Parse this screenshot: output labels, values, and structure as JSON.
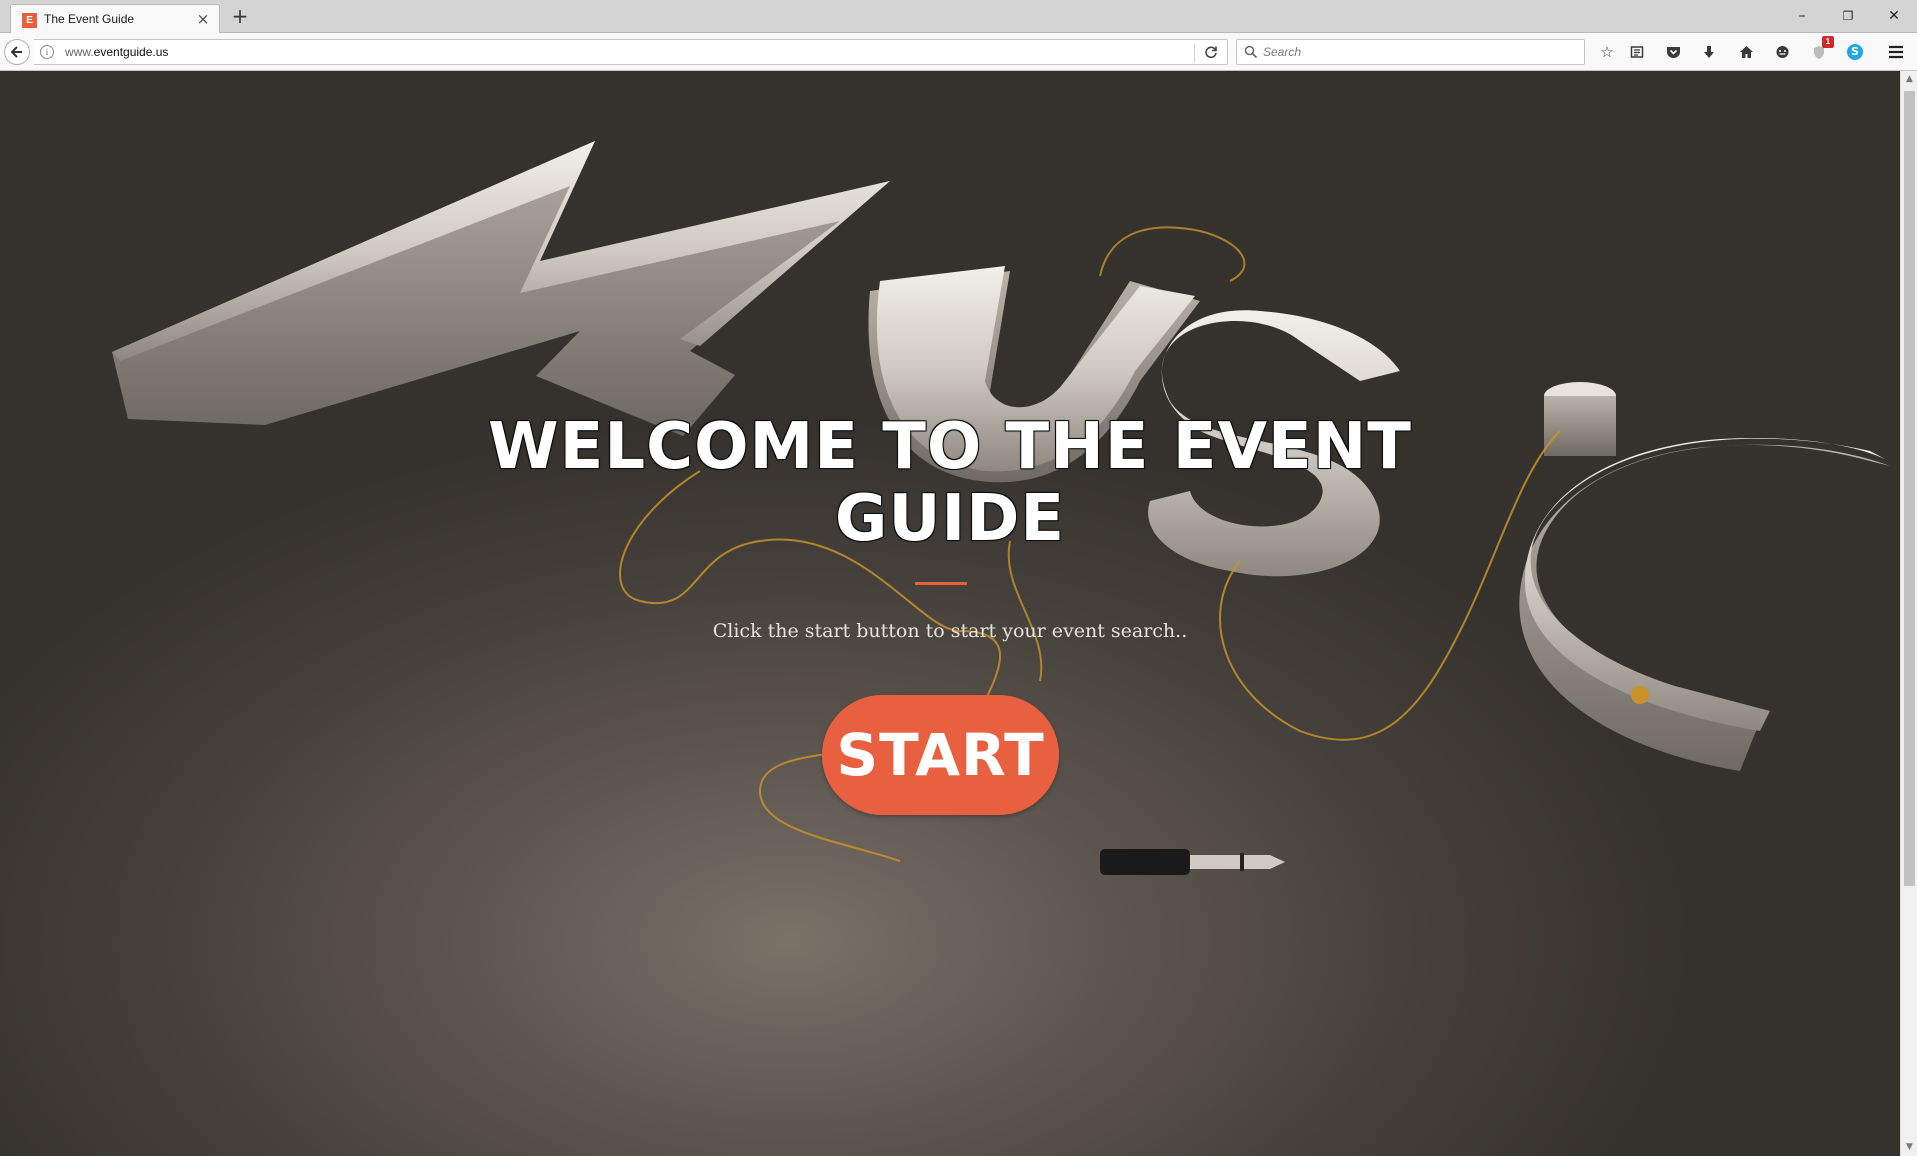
{
  "browser": {
    "tab": {
      "favicon_letter": "E",
      "title": "The Event Guide"
    },
    "new_tab_label": "+",
    "window_controls": {
      "minimize": "–",
      "maximize": "❐",
      "close": "✕"
    },
    "url": {
      "prefix": "www.",
      "domain": "eventguide.us"
    },
    "search": {
      "placeholder": "Search"
    },
    "toolbar_icons": [
      "bookmark-star-icon",
      "reading-list-icon",
      "pocket-icon",
      "download-icon",
      "home-icon",
      "chat-icon",
      "shield-icon",
      "skype-icon",
      "menu-icon"
    ],
    "shield_badge": "1",
    "skype_label": "S"
  },
  "hero": {
    "title": "WELCOME TO THE EVENT GUIDE",
    "subtitle": "Click the start button to start your event search..",
    "button_label": "START"
  },
  "colors": {
    "accent": "#e8603f",
    "background": "#4a4540"
  }
}
